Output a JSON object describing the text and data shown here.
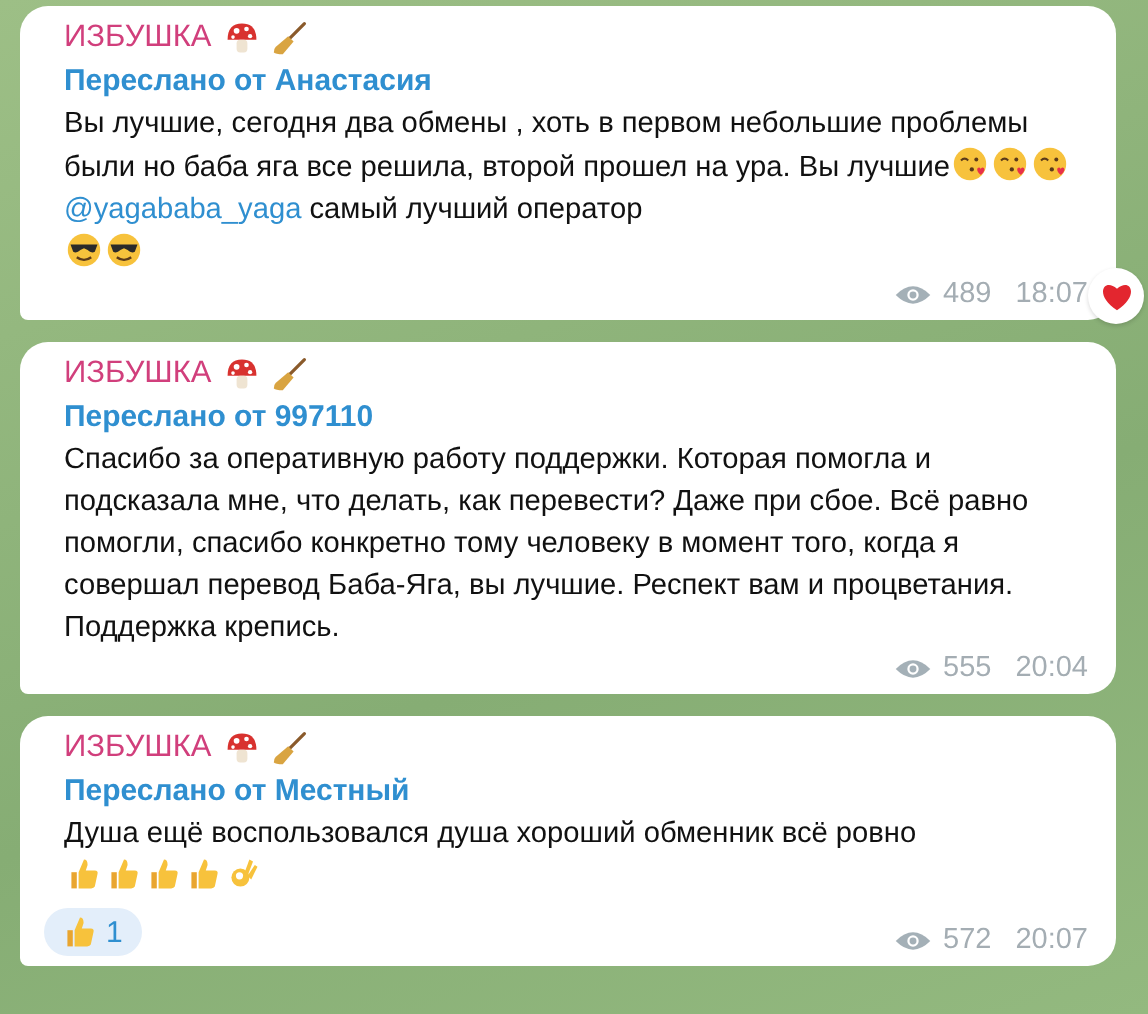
{
  "messages": [
    {
      "channel": "ИЗБУШКА",
      "channel_emojis": [
        {
          "kind": "mushroom"
        },
        {
          "kind": "broom"
        }
      ],
      "forwarded": "Переслано от Анастасия",
      "paragraphs": [
        {
          "parts": [
            {
              "kind": "text",
              "text": "Вы лучшие, сегодня два обмены , хоть в первом небольшие проблемы были но  баба яга все решила, второй прошел на ура. Вы лучшие"
            },
            {
              "kind": "kiss"
            },
            {
              "kind": "kiss"
            },
            {
              "kind": "kiss"
            }
          ]
        },
        {
          "parts": [
            {
              "kind": "link",
              "text": "@yagababa_yaga"
            },
            {
              "kind": "text",
              "text": " самый лучший оператор"
            }
          ]
        },
        {
          "parts": [
            {
              "kind": "sunglasses"
            },
            {
              "kind": "sunglasses"
            }
          ]
        }
      ],
      "views": "489",
      "time": "18:07",
      "corner_reaction": {
        "kind": "heart"
      }
    },
    {
      "channel": "ИЗБУШКА",
      "channel_emojis": [
        {
          "kind": "mushroom"
        },
        {
          "kind": "broom"
        }
      ],
      "forwarded": "Переслано от 997110",
      "paragraphs": [
        {
          "parts": [
            {
              "kind": "text",
              "text": "Спасибо за оперативную работу поддержки. Которая помогла и подсказала мне, что делать, как перевести? Даже при сбое. Всё равно помогли, спасибо конкретно тому человеку в момент того, когда я совершал перевод Баба-Яга, вы лучшие. Респект вам и процветания. Поддержка крепись."
            }
          ]
        }
      ],
      "views": "555",
      "time": "20:04"
    },
    {
      "channel": "ИЗБУШКА",
      "channel_emojis": [
        {
          "kind": "mushroom"
        },
        {
          "kind": "broom"
        }
      ],
      "forwarded": "Переслано от Местный",
      "paragraphs": [
        {
          "parts": [
            {
              "kind": "text",
              "text": "Душа ещё воспользовался душа хороший обменник всё ровно"
            }
          ]
        },
        {
          "parts": [
            {
              "kind": "thumbs_up"
            },
            {
              "kind": "thumbs_up"
            },
            {
              "kind": "thumbs_up"
            },
            {
              "kind": "thumbs_up"
            },
            {
              "kind": "ok_hand"
            }
          ]
        }
      ],
      "reaction": {
        "kind": "thumbs_up",
        "count": "1"
      },
      "views": "572",
      "time": "20:07"
    }
  ]
}
